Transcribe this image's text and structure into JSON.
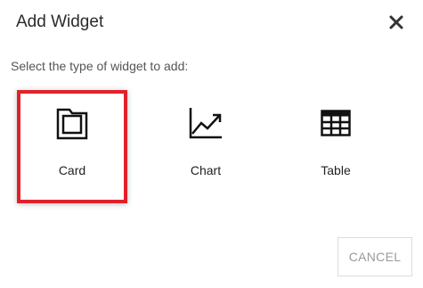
{
  "dialog": {
    "title": "Add Widget",
    "close_icon": "close-icon",
    "prompt": "Select the type of widget to add:",
    "options": [
      {
        "label": "Card",
        "icon": "folder-icon",
        "selected": true
      },
      {
        "label": "Chart",
        "icon": "line-chart-icon",
        "selected": false
      },
      {
        "label": "Table",
        "icon": "table-icon",
        "selected": false
      }
    ],
    "cancel_label": "CANCEL"
  },
  "colors": {
    "selected_border": "#e0212b",
    "text": "#222222",
    "muted": "#9a9a9a"
  }
}
